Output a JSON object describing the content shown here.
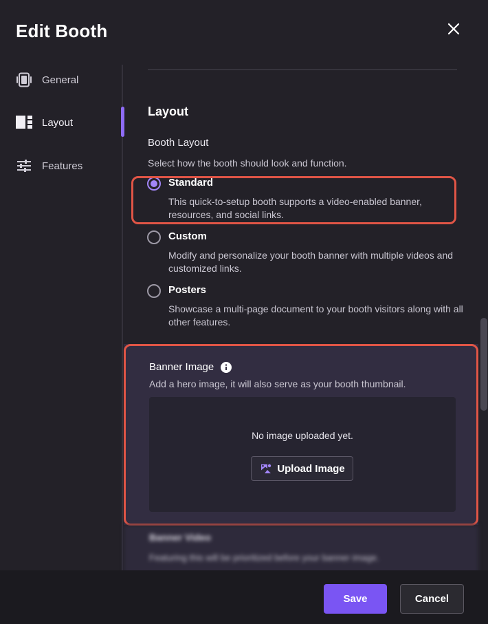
{
  "dialog": {
    "title": "Edit Booth"
  },
  "sidebar": {
    "items": [
      {
        "label": "General",
        "icon": "booth-icon"
      },
      {
        "label": "Layout",
        "icon": "layout-icon",
        "active": true
      },
      {
        "label": "Features",
        "icon": "sliders-icon"
      }
    ]
  },
  "layout_section": {
    "heading": "Layout",
    "field_label": "Booth Layout",
    "field_description": "Select how the booth should look and function.",
    "options": [
      {
        "title": "Standard",
        "description": "This quick-to-setup booth supports a video-enabled banner, resources, and social links.",
        "selected": true
      },
      {
        "title": "Custom",
        "description": "Modify and personalize your booth banner with multiple videos and customized links.",
        "selected": false
      },
      {
        "title": "Posters",
        "description": "Showcase a multi-page document to your booth visitors along with all other features.",
        "selected": false
      }
    ]
  },
  "banner_image": {
    "label": "Banner Image",
    "description": "Add a hero image, it will also serve as your booth thumbnail.",
    "empty_text": "No image uploaded yet.",
    "upload_label": "Upload Image"
  },
  "banner_video": {
    "label": "Banner Video",
    "description": "Featuring this will be prioritized before your banner image."
  },
  "footer": {
    "save_label": "Save",
    "cancel_label": "Cancel"
  },
  "colors": {
    "accent": "#7a55f3",
    "highlight": "#e05546",
    "background": "#232128"
  }
}
